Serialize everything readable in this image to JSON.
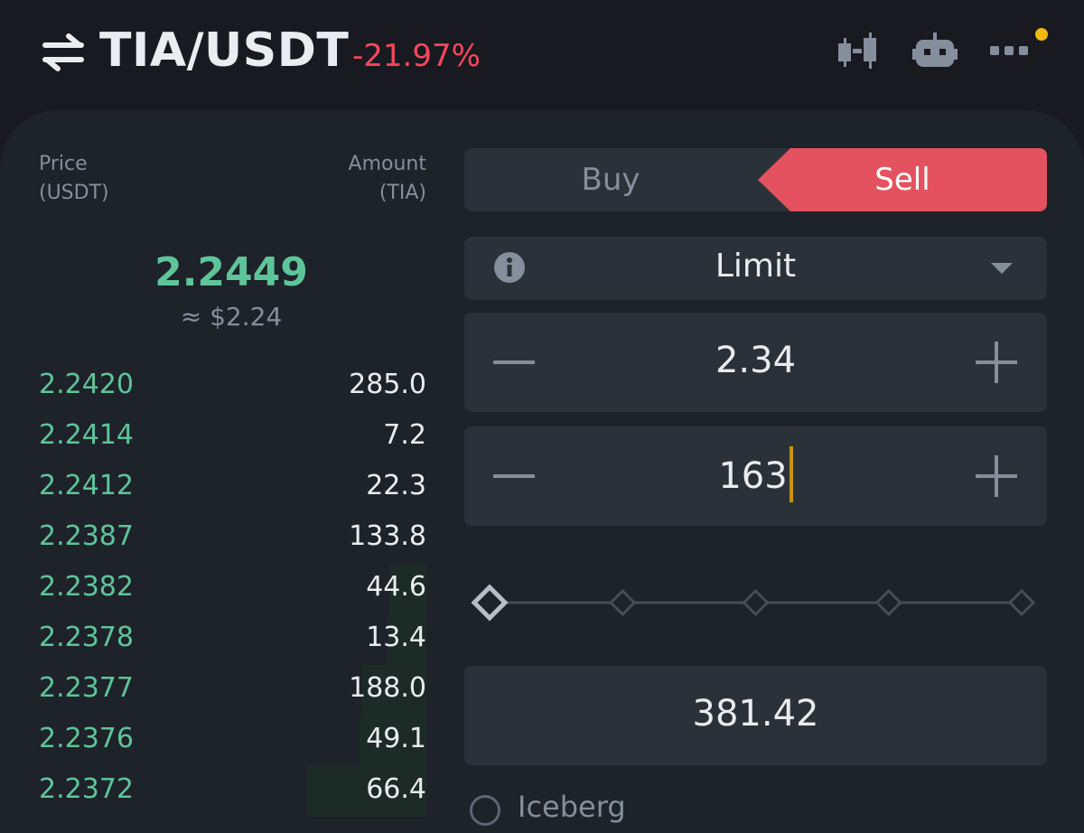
{
  "header": {
    "pair": "TIA/USDT",
    "change": "-21.97%",
    "icons": [
      "swap-arrows-icon",
      "candlestick-chart-icon",
      "robot-icon",
      "more-icon"
    ],
    "notification_dot_color": "#f0b90b"
  },
  "order_book": {
    "price_header": "Price",
    "price_unit": "(USDT)",
    "amount_header": "Amount",
    "amount_unit": "(TIA)",
    "last_price": "2.2449",
    "last_price_usd": "≈ $2.24",
    "rows": [
      {
        "price": "2.2420",
        "amount": "285.0",
        "depth": 0.0
      },
      {
        "price": "2.2414",
        "amount": "7.2",
        "depth": 0.0
      },
      {
        "price": "2.2412",
        "amount": "22.3",
        "depth": 0.0
      },
      {
        "price": "2.2387",
        "amount": "133.8",
        "depth": 0.0
      },
      {
        "price": "2.2382",
        "amount": "44.6",
        "depth": 0.17
      },
      {
        "price": "2.2378",
        "amount": "13.4",
        "depth": 0.18
      },
      {
        "price": "2.2377",
        "amount": "188.0",
        "depth": 0.3
      },
      {
        "price": "2.2376",
        "amount": "49.1",
        "depth": 0.31
      },
      {
        "price": "2.2372",
        "amount": "66.4",
        "depth": 0.56
      }
    ]
  },
  "form": {
    "buy_label": "Buy",
    "sell_label": "Sell",
    "order_type": "Limit",
    "price_value": "2.34",
    "amount_value": "163",
    "slider_level": 0.0,
    "slider_steps": 5,
    "total_value": "381.42",
    "iceberg_label": "Iceberg"
  },
  "colors": {
    "background": "#181a20",
    "panel": "#1e2229",
    "sell": "#e4525f",
    "buy_green": "#5ec49a",
    "negative": "#f6465d",
    "muted": "#848e9c"
  }
}
